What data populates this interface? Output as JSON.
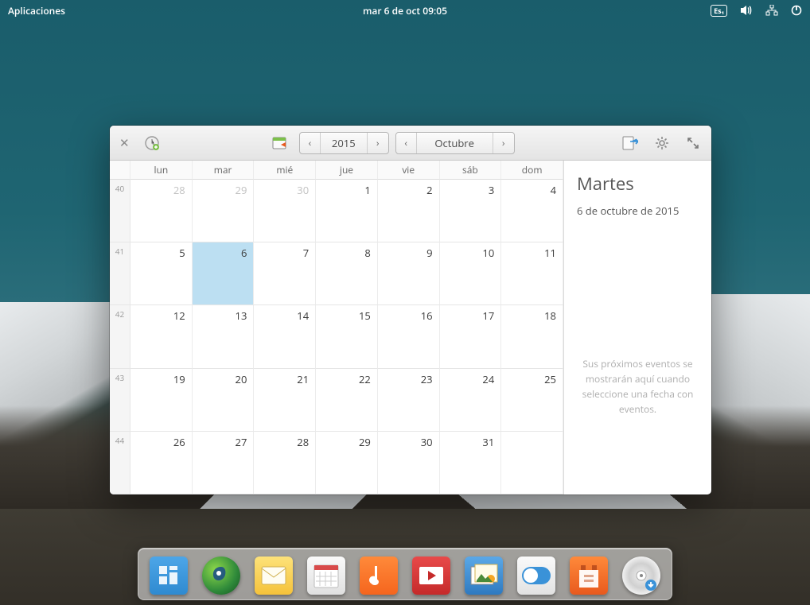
{
  "panel": {
    "apps_menu": "Aplicaciones",
    "clock": "mar  6 de oct   09:05",
    "keyboard_indicator": "Es₁"
  },
  "calendar_window": {
    "year": "2015",
    "month": "Octubre",
    "day_headers": [
      "lun",
      "mar",
      "mié",
      "jue",
      "vie",
      "sáb",
      "dom"
    ],
    "weeks": [
      "40",
      "41",
      "42",
      "43",
      "44"
    ],
    "cells": [
      {
        "n": "28",
        "outside": true
      },
      {
        "n": "29",
        "outside": true
      },
      {
        "n": "30",
        "outside": true
      },
      {
        "n": "1"
      },
      {
        "n": "2"
      },
      {
        "n": "3"
      },
      {
        "n": "4"
      },
      {
        "n": "5"
      },
      {
        "n": "6",
        "today": true
      },
      {
        "n": "7"
      },
      {
        "n": "8"
      },
      {
        "n": "9"
      },
      {
        "n": "10"
      },
      {
        "n": "11"
      },
      {
        "n": "12"
      },
      {
        "n": "13"
      },
      {
        "n": "14"
      },
      {
        "n": "15"
      },
      {
        "n": "16"
      },
      {
        "n": "17"
      },
      {
        "n": "18"
      },
      {
        "n": "19"
      },
      {
        "n": "20"
      },
      {
        "n": "21"
      },
      {
        "n": "22"
      },
      {
        "n": "23"
      },
      {
        "n": "24"
      },
      {
        "n": "25"
      },
      {
        "n": "26"
      },
      {
        "n": "27"
      },
      {
        "n": "28"
      },
      {
        "n": "29"
      },
      {
        "n": "30"
      },
      {
        "n": "31"
      },
      {
        "n": "",
        "outside": true
      }
    ],
    "sidebar": {
      "day_name": "Martes",
      "full_date": "6 de octubre de 2015",
      "empty_message": "Sus próximos eventos se mostrarán aquí cuando seleccione una fecha con eventos."
    }
  },
  "dock": {
    "items": [
      {
        "name": "multitask"
      },
      {
        "name": "browser"
      },
      {
        "name": "mail"
      },
      {
        "name": "calendar"
      },
      {
        "name": "music"
      },
      {
        "name": "videos"
      },
      {
        "name": "photos"
      },
      {
        "name": "settings"
      },
      {
        "name": "software"
      },
      {
        "name": "disc"
      }
    ]
  }
}
